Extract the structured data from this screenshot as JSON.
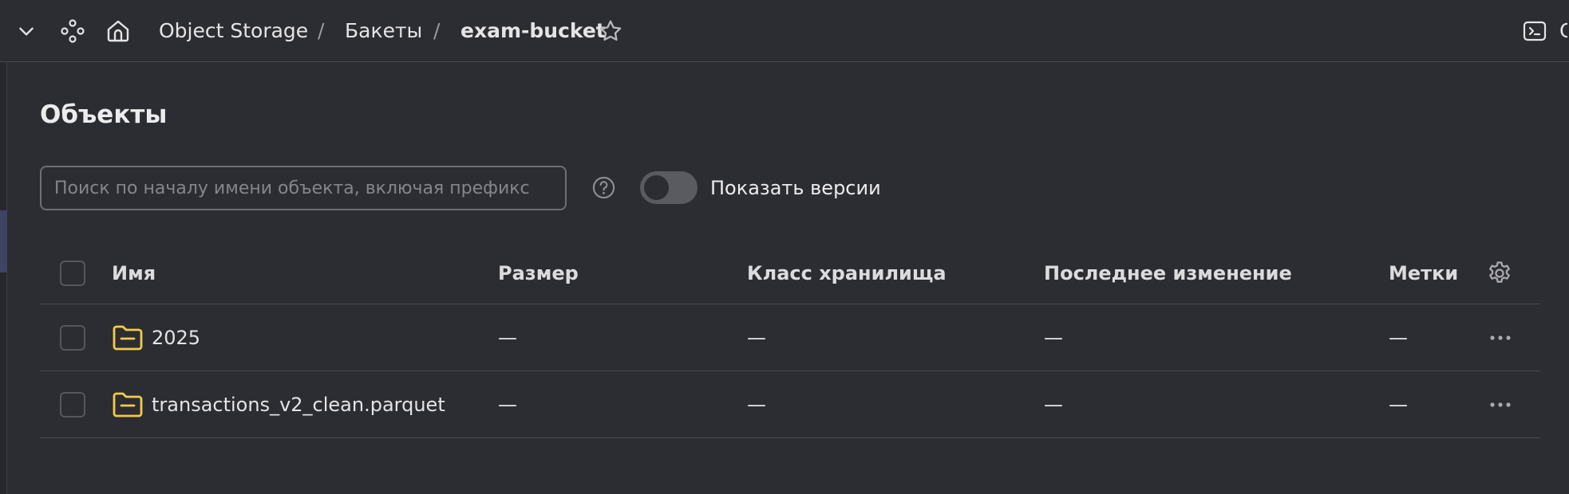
{
  "header": {
    "breadcrumbs": [
      {
        "label": "Object Storage"
      },
      {
        "label": "Бакеты"
      },
      {
        "label": "exam-bucket"
      }
    ],
    "separator": "/",
    "right_action_label_truncated": "C",
    "icons": {
      "collapse": "chevron-down-icon",
      "services": "services-icon",
      "home": "home-icon",
      "favorite": "star-icon",
      "terminal": "terminal-icon"
    }
  },
  "main": {
    "title": "Объекты",
    "search": {
      "placeholder": "Поиск по началу имени объекта, включая префикс",
      "value": ""
    },
    "show_versions": {
      "label": "Показать версии",
      "enabled": false
    }
  },
  "table": {
    "columns": [
      {
        "key": "name",
        "label": "Имя"
      },
      {
        "key": "size",
        "label": "Размер"
      },
      {
        "key": "storage_class",
        "label": "Класс хранилища"
      },
      {
        "key": "modified",
        "label": "Последнее изменение"
      },
      {
        "key": "tags",
        "label": "Метки"
      }
    ],
    "rows": [
      {
        "name": "2025",
        "type": "folder",
        "size": "—",
        "storage_class": "—",
        "modified": "—",
        "tags": "—"
      },
      {
        "name": "transactions_v2_clean.parquet",
        "type": "folder",
        "size": "—",
        "storage_class": "—",
        "modified": "—",
        "tags": "—"
      }
    ]
  },
  "colors": {
    "background": "#2c2c33",
    "folder_icon": "#f2cc47",
    "border": "#4a4a51",
    "text": "#e4e4e6",
    "muted": "#85858c"
  }
}
